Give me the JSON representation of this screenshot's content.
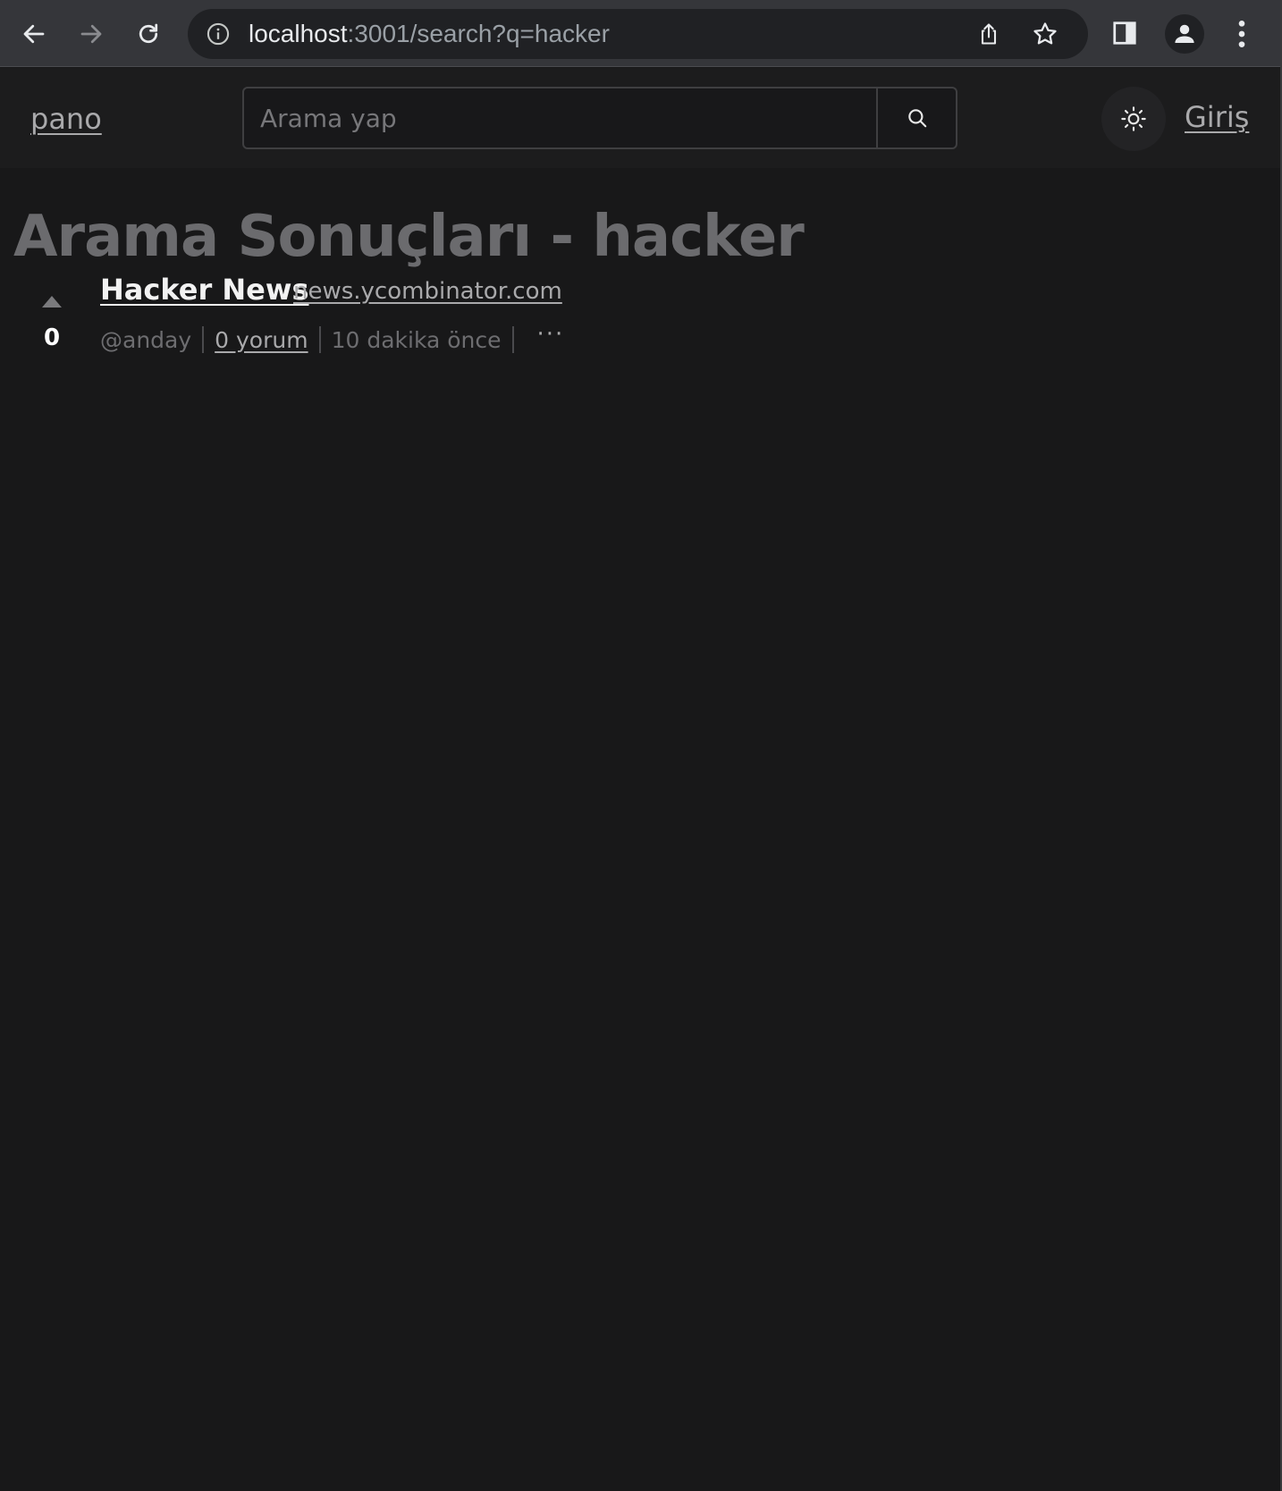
{
  "browser": {
    "url_host": "localhost",
    "url_rest": ":3001/search?q=hacker"
  },
  "header": {
    "logo": "pano",
    "search_placeholder": "Arama yap",
    "login_label": "Giriş"
  },
  "page": {
    "title": "Arama Sonuçları - hacker"
  },
  "results": [
    {
      "votes": "0",
      "title": "Hacker News",
      "domain": "news.ycombinator.com",
      "author": "@anday",
      "comments": "0 yorum",
      "time": "10 dakika önce",
      "more": "···"
    }
  ]
}
